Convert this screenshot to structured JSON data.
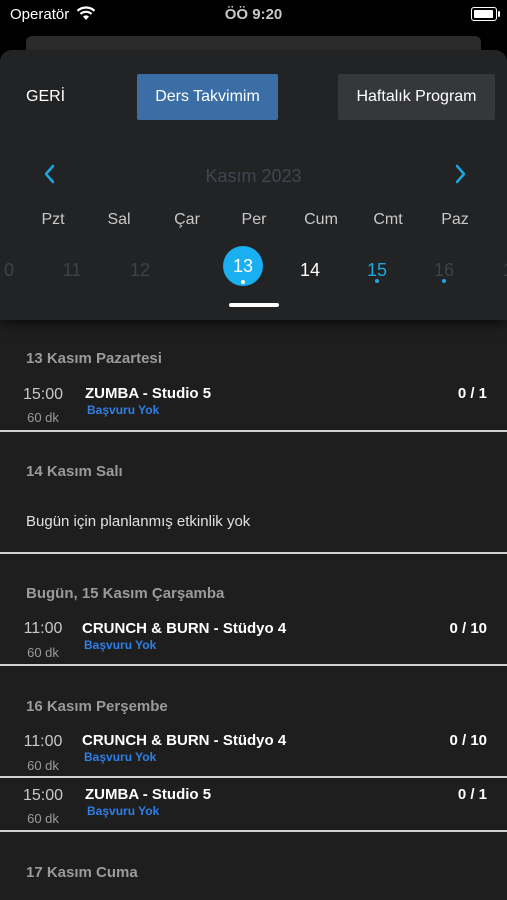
{
  "status": {
    "carrier": "Operatör",
    "time": "ÖÖ 9:20"
  },
  "header": {
    "back": "GERİ",
    "tab_active": "Ders Takvimim",
    "tab_other": "Haftalık Program",
    "month": "Kasım 2023",
    "weekdays": [
      "Pzt",
      "Sal",
      "Çar",
      "Per",
      "Cum",
      "Cmt",
      "Paz"
    ],
    "days": [
      "0",
      "11",
      "12",
      "13",
      "14",
      "15",
      "16",
      "1"
    ]
  },
  "colors": {
    "accent": "#1da7e0",
    "primary_btn": "#3a6ea5",
    "link": "#2f7fe6"
  },
  "sections": [
    {
      "title": "13 Kasım Pazartesi",
      "events": [
        {
          "time": "15:00",
          "dur": "60 dk",
          "name": "ZUMBA - Studio 5",
          "status": "Başvuru Yok",
          "count": "0 / 1"
        }
      ]
    },
    {
      "title": "14 Kasım Salı",
      "empty": "Bugün için planlanmış etkinlik yok"
    },
    {
      "title": "Bugün, 15 Kasım Çarşamba",
      "events": [
        {
          "time": "11:00",
          "dur": "60 dk",
          "name": "CRUNCH & BURN - Stüdyo 4",
          "status": "Başvuru Yok",
          "count": "0 / 10"
        }
      ]
    },
    {
      "title": "16 Kasım Perşembe",
      "events": [
        {
          "time": "11:00",
          "dur": "60 dk",
          "name": "CRUNCH & BURN - Stüdyo 4",
          "status": "Başvuru Yok",
          "count": "0 / 10"
        },
        {
          "time": "15:00",
          "dur": "60 dk",
          "name": "ZUMBA - Studio 5",
          "status": "Başvuru Yok",
          "count": "0 / 1"
        }
      ]
    },
    {
      "title": "17 Kasım Cuma"
    }
  ]
}
